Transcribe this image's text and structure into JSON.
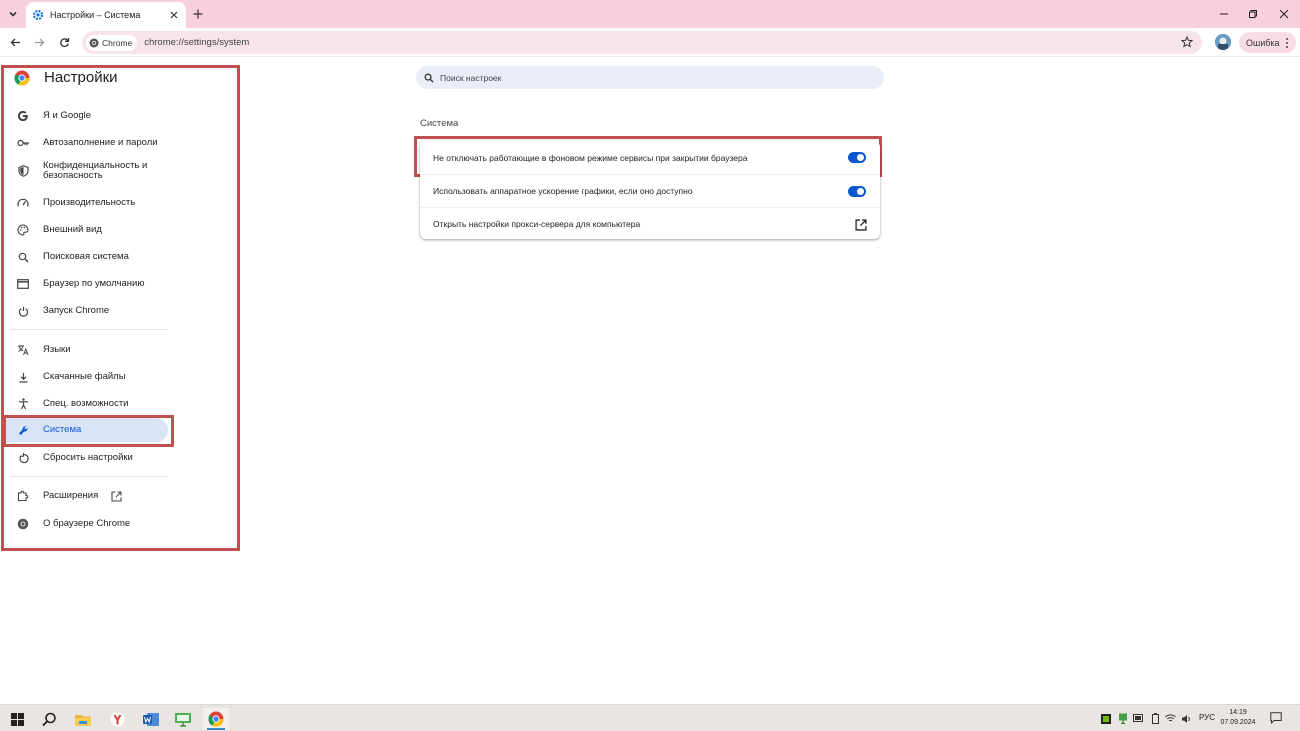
{
  "browser": {
    "tab": {
      "title": "Настройки – Система"
    },
    "toolbar": {
      "site_chip": "Chrome",
      "url": "chrome://settings/system",
      "error_label": "Ошибка"
    }
  },
  "sidebar": {
    "title": "Настройки",
    "items": [
      {
        "label": "Я и Google",
        "icon": "google-icon"
      },
      {
        "label": "Автозаполнение и пароли",
        "icon": "key-icon"
      },
      {
        "label": "Конфиденциальность и безопасность",
        "icon": "shield-icon"
      },
      {
        "label": "Производительность",
        "icon": "speedometer-icon"
      },
      {
        "label": "Внешний вид",
        "icon": "palette-icon"
      },
      {
        "label": "Поисковая система",
        "icon": "search-icon"
      },
      {
        "label": "Браузер по умолчанию",
        "icon": "browser-window-icon"
      },
      {
        "label": "Запуск Chrome",
        "icon": "power-icon"
      },
      {
        "label": "Языки",
        "icon": "translate-icon"
      },
      {
        "label": "Скачанные файлы",
        "icon": "download-icon"
      },
      {
        "label": "Спец. возможности",
        "icon": "accessibility-icon"
      },
      {
        "label": "Система",
        "icon": "wrench-icon",
        "active": true
      },
      {
        "label": "Сбросить настройки",
        "icon": "reset-icon"
      },
      {
        "label": "Расширения",
        "icon": "puzzle-icon"
      },
      {
        "label": "О браузере Chrome",
        "icon": "chrome-icon"
      }
    ]
  },
  "main": {
    "search_placeholder": "Поиск настроек",
    "section_title": "Система",
    "rows": [
      {
        "label": "Не отключать работающие в фоновом режиме сервисы при закрытии браузера",
        "control": "toggle",
        "on": true
      },
      {
        "label": "Использовать аппаратное ускорение графики, если оно доступно",
        "control": "toggle",
        "on": true
      },
      {
        "label": "Открыть настройки прокси-сервера для компьютера",
        "control": "external-link-icon"
      }
    ]
  },
  "taskbar": {
    "apps": [
      "windows-start-icon",
      "search-icon",
      "file-explorer-icon",
      "yandex-browser-icon",
      "word-icon",
      "presentation-app-icon",
      "chrome-icon"
    ],
    "language": "РУС",
    "time": "14:19",
    "date": "07.09.2024"
  },
  "colors": {
    "accent": "#0b57d0",
    "highlight_border": "#c0504d",
    "tabstrip": "#f8d0dc"
  }
}
